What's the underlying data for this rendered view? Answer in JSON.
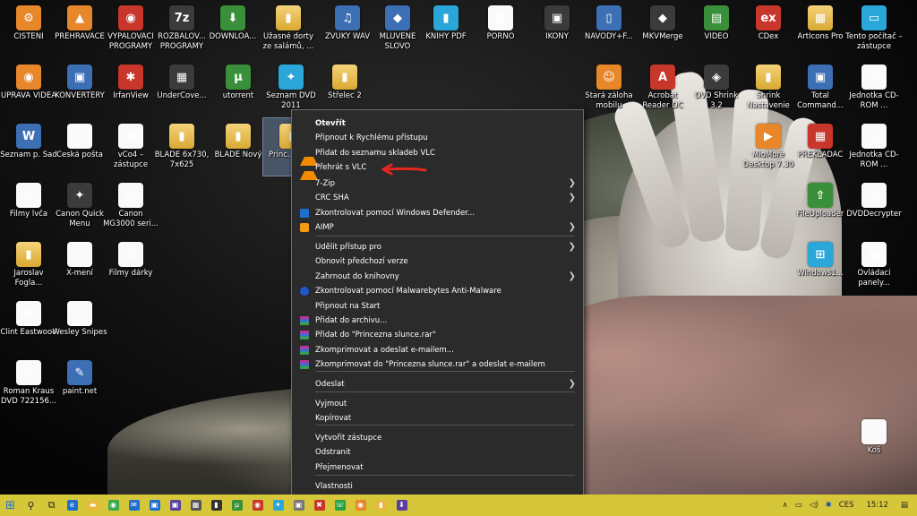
{
  "desktop": {
    "icons": [
      {
        "label": "ČIŠTĚNÍ",
        "glyph": "⚙",
        "style": "g-orange"
      },
      {
        "label": "PŘEHRÁVAČE",
        "glyph": "▲",
        "style": "g-orange"
      },
      {
        "label": "VYPALOVACÍ PROGRAMY",
        "glyph": "◉",
        "style": "g-red"
      },
      {
        "label": "ROZBALOV... PROGRAMY",
        "glyph": "7z",
        "style": "g-dark"
      },
      {
        "label": "DOWNLOA...",
        "glyph": "⬇",
        "style": "g-green"
      },
      {
        "label": "Úžasné dorty ze salámů, ...",
        "glyph": "▮",
        "style": "g-folder"
      },
      {
        "label": "ZVUKY WAV",
        "glyph": "♫",
        "style": "g-app"
      },
      {
        "label": "MLUVENÉ SLOVO",
        "glyph": "◆",
        "style": "g-app"
      },
      {
        "label": "KNIHY PDF",
        "glyph": "▮",
        "style": "g-cyan"
      },
      {
        "label": "PORNO",
        "glyph": "▦",
        "style": "g-doc"
      },
      {
        "label": "IKONY",
        "glyph": "▣",
        "style": "g-dark"
      },
      {
        "label": "NÁVODY+F...",
        "glyph": "▯",
        "style": "g-app"
      },
      {
        "label": "MKVMerge",
        "glyph": "◆",
        "style": "g-dark"
      },
      {
        "label": "VIDEO",
        "glyph": "▤",
        "style": "g-green"
      },
      {
        "label": "CDex",
        "glyph": "ex",
        "style": "g-red"
      },
      {
        "label": "ArtIcons Pro",
        "glyph": "▦",
        "style": "g-folder"
      },
      {
        "label": "Tento počítač – zástupce",
        "glyph": "▭",
        "style": "g-cyan"
      },
      {
        "label": "ÚPRAVA VIDEA",
        "glyph": "◉",
        "style": "g-orange"
      },
      {
        "label": "KONVERTERY",
        "glyph": "▣",
        "style": "g-app"
      },
      {
        "label": "IrfanView",
        "glyph": "✱",
        "style": "g-red"
      },
      {
        "label": "UnderCove...",
        "glyph": "▦",
        "style": "g-dark"
      },
      {
        "label": "utorrent",
        "glyph": "µ",
        "style": "g-green"
      },
      {
        "label": "Seznam DVD 2011",
        "glyph": "✦",
        "style": "g-cyan"
      },
      {
        "label": "Střelec 2",
        "glyph": "▮",
        "style": "g-folder"
      },
      {
        "label": "Stará záloha mobilu",
        "glyph": "☺",
        "style": "g-orange"
      },
      {
        "label": "Acrobat Reader DC",
        "glyph": "A",
        "style": "g-red"
      },
      {
        "label": "DVD Shrink 3.2",
        "glyph": "◈",
        "style": "g-dark"
      },
      {
        "label": "Shrink Nastavenie",
        "glyph": "▮",
        "style": "g-folder"
      },
      {
        "label": "Total Command...",
        "glyph": "▣",
        "style": "g-app"
      },
      {
        "label": "Jednotka CD-ROM ...",
        "glyph": "◎",
        "style": "g-doc"
      },
      {
        "label": "Seznam p. Sad",
        "glyph": "W",
        "style": "g-app"
      },
      {
        "label": "Česká pošta",
        "glyph": "≡",
        "style": "g-doc"
      },
      {
        "label": "vCo4 – zástupce",
        "glyph": "≡",
        "style": "g-doc"
      },
      {
        "label": "BLADE 6x730, 7x625",
        "glyph": "▮",
        "style": "g-folder"
      },
      {
        "label": "BLADE Nový",
        "glyph": "▮",
        "style": "g-folder"
      },
      {
        "label": "Princ... slu...",
        "glyph": "▮",
        "style": "g-folder",
        "selected": true
      },
      {
        "label": "MioMore Desktop 7.30",
        "glyph": "▶",
        "style": "g-orange"
      },
      {
        "label": "PŘEKLADAČ",
        "glyph": "▦",
        "style": "g-red"
      },
      {
        "label": "Jednotka CD-ROM ...",
        "glyph": "◎",
        "style": "g-doc"
      },
      {
        "label": "Filmy lvča",
        "glyph": "≡",
        "style": "g-doc"
      },
      {
        "label": "Canon Quick Menu",
        "glyph": "✦",
        "style": "g-dark"
      },
      {
        "label": "Canon MG3000 seri...",
        "glyph": "▤",
        "style": "g-doc"
      },
      {
        "label": "FileUploader",
        "glyph": "⇧",
        "style": "g-green"
      },
      {
        "label": "DVDDecrypter",
        "glyph": "◎",
        "style": "g-doc"
      },
      {
        "label": "Jaroslav Fogla...",
        "glyph": "▮",
        "style": "g-folder"
      },
      {
        "label": "X-mení",
        "glyph": "≡",
        "style": "g-doc"
      },
      {
        "label": "Filmy dárky",
        "glyph": "≡",
        "style": "g-doc"
      },
      {
        "label": "Windows1...",
        "glyph": "⊞",
        "style": "g-cyan"
      },
      {
        "label": "Ovládací panely...",
        "glyph": "▦",
        "style": "g-doc"
      },
      {
        "label": "Clint Eastwood",
        "glyph": "≡",
        "style": "g-doc"
      },
      {
        "label": "Wesley Snipes",
        "glyph": "≡",
        "style": "g-doc"
      },
      {
        "label": "Roman Kraus DVD 722156...",
        "glyph": "≡",
        "style": "g-doc"
      },
      {
        "label": "paint.net",
        "glyph": "✎",
        "style": "g-app"
      },
      {
        "label": "Koš",
        "glyph": "♲",
        "style": "g-doc"
      }
    ]
  },
  "context_menu": {
    "items": [
      {
        "label": "Otevřít",
        "bold": true,
        "icon": ""
      },
      {
        "label": "Připnout k Rychlému přístupu",
        "icon": ""
      },
      {
        "label": "Přidat do seznamu skladeb VLC",
        "icon": "vlc"
      },
      {
        "label": "Přehrát s VLC",
        "icon": "vlc"
      },
      {
        "label": "7-Zip",
        "icon": "",
        "submenu": true
      },
      {
        "label": "CRC SHA",
        "icon": "",
        "submenu": true
      },
      {
        "label": "Zkontrolovat pomocí Windows Defender...",
        "icon": "shield"
      },
      {
        "label": "AIMP",
        "icon": "aimp",
        "submenu": true
      },
      {
        "label": "Udělit přístup pro",
        "icon": "",
        "submenu": true
      },
      {
        "label": "Obnovit předchozí verze",
        "icon": ""
      },
      {
        "label": "Zahrnout do knihovny",
        "icon": "",
        "submenu": true
      },
      {
        "label": "Zkontrolovat pomocí Malwarebytes Anti-Malware",
        "icon": "mbam"
      },
      {
        "label": "Připnout na Start",
        "icon": ""
      },
      {
        "label": "Přidat do archivu...",
        "icon": "rar"
      },
      {
        "label": "Přidat do \"Princezna slunce.rar\"",
        "icon": "rar"
      },
      {
        "label": "Zkomprimovat a odeslat e-mailem...",
        "icon": "rar"
      },
      {
        "label": "Zkomprimovat do \"Princezna slunce.rar\" a odeslat e-mailem",
        "icon": "rar"
      },
      {
        "label": "Odeslat",
        "icon": "",
        "submenu": true
      },
      {
        "label": "Vyjmout",
        "icon": ""
      },
      {
        "label": "Kopírovat",
        "icon": ""
      },
      {
        "label": "Vytvořit zástupce",
        "icon": ""
      },
      {
        "label": "Odstranit",
        "icon": ""
      },
      {
        "label": "Přejmenovat",
        "icon": ""
      },
      {
        "label": "Vlastnosti",
        "icon": ""
      }
    ],
    "submenu_glyph": "❯"
  },
  "taskbar": {
    "start_glyph": "⊞",
    "search_glyph": "⚲",
    "taskview_glyph": "⧉",
    "apps": [
      {
        "name": "edge",
        "color": "#1f6fd1",
        "glyph": "e"
      },
      {
        "name": "explorer",
        "color": "#e8b93a",
        "glyph": "▬"
      },
      {
        "name": "chrome",
        "color": "#3aa84a",
        "glyph": "◉"
      },
      {
        "name": "mail",
        "color": "#1f6fd1",
        "glyph": "✉"
      },
      {
        "name": "store",
        "color": "#1f6fd1",
        "glyph": "▣"
      },
      {
        "name": "app-purple",
        "color": "#5a3fa0",
        "glyph": "▣"
      },
      {
        "name": "calculator",
        "color": "#555555",
        "glyph": "▦"
      },
      {
        "name": "app-dark",
        "color": "#333333",
        "glyph": "▮"
      },
      {
        "name": "utorrent",
        "color": "#3a8f3a",
        "glyph": "µ"
      },
      {
        "name": "app-red",
        "color": "#c8362c",
        "glyph": "◉"
      },
      {
        "name": "seznam",
        "color": "#2aa6d8",
        "glyph": "✦"
      },
      {
        "name": "app-gray",
        "color": "#777777",
        "glyph": "▣"
      },
      {
        "name": "app-x",
        "color": "#c8362c",
        "glyph": "✖"
      },
      {
        "name": "whatsapp",
        "color": "#25a244",
        "glyph": "☏"
      },
      {
        "name": "app-orange",
        "color": "#e8862a",
        "glyph": "◉"
      },
      {
        "name": "app-folder",
        "color": "#e8b93a",
        "glyph": "▮"
      },
      {
        "name": "download",
        "color": "#5a3fa0",
        "glyph": "⬇"
      }
    ],
    "tray": {
      "chevron": "∧",
      "lang": "CES",
      "time": "15:12",
      "notification_glyph": "▤"
    }
  },
  "colors": {
    "menu_bg": "#2b2b2b",
    "taskbar": "#d6c63a",
    "selection": "#7896be",
    "annotation_arrow": "#e8261e"
  }
}
